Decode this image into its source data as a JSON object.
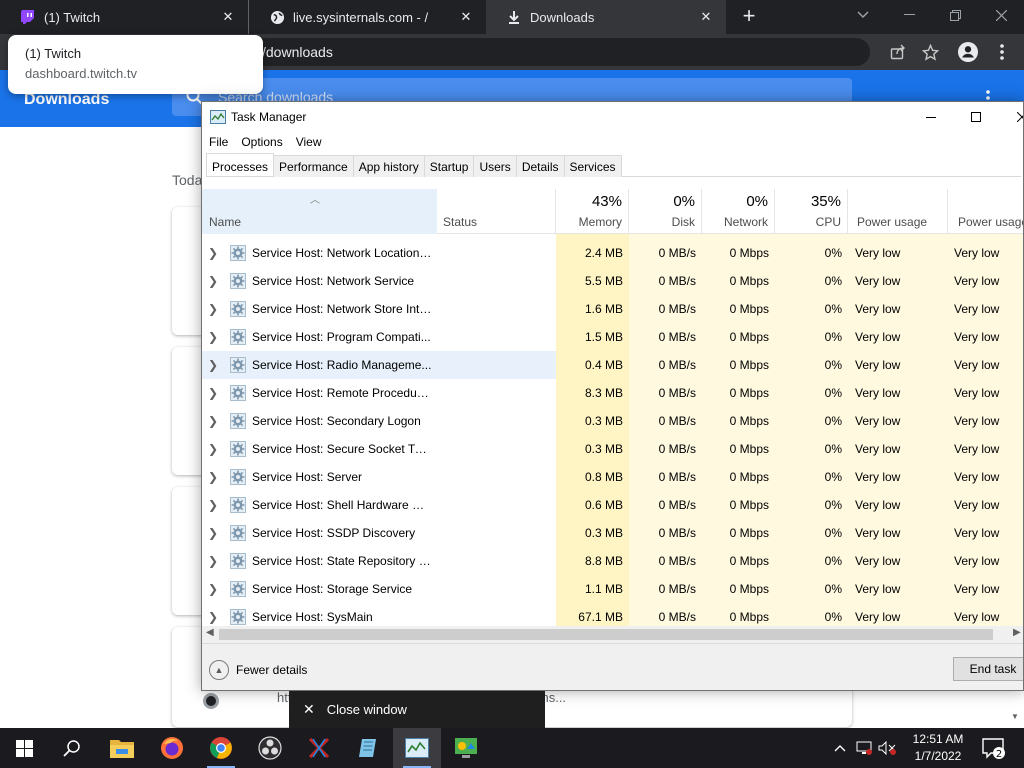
{
  "browser": {
    "tabs": [
      {
        "title": "(1) Twitch",
        "active": false
      },
      {
        "title": "live.sysinternals.com - /",
        "active": false
      },
      {
        "title": "Downloads",
        "active": true
      }
    ],
    "address": "/downloads",
    "tooltip": {
      "title": "(1) Twitch",
      "url": "dashboard.twitch.tv"
    }
  },
  "downloads": {
    "title": "Downloads",
    "search_placeholder": "Search downloads",
    "section": "Toda",
    "file_text": "https://...asy_epic_music_1_hour_orchestral_ins..."
  },
  "taskmgr": {
    "title": "Task Manager",
    "menu": [
      "File",
      "Options",
      "View"
    ],
    "tabs": [
      "Processes",
      "Performance",
      "App history",
      "Startup",
      "Users",
      "Details",
      "Services"
    ],
    "active_tab": "Processes",
    "columns": {
      "name": "Name",
      "status": "Status",
      "memory": {
        "pct": "43%",
        "label": "Memory"
      },
      "disk": {
        "pct": "0%",
        "label": "Disk"
      },
      "network": {
        "pct": "0%",
        "label": "Network"
      },
      "cpu": {
        "pct": "35%",
        "label": "CPU"
      },
      "power": "Power usage",
      "power_trend": "Power usage"
    },
    "rows": [
      {
        "name": "Service Host: Network Location ...",
        "memory": "2.4 MB",
        "disk": "0 MB/s",
        "network": "0 Mbps",
        "cpu": "0%",
        "power": "Very low",
        "power_trend": "Very low"
      },
      {
        "name": "Service Host: Network Service",
        "memory": "5.5 MB",
        "disk": "0 MB/s",
        "network": "0 Mbps",
        "cpu": "0%",
        "power": "Very low",
        "power_trend": "Very low"
      },
      {
        "name": "Service Host: Network Store Inte...",
        "memory": "1.6 MB",
        "disk": "0 MB/s",
        "network": "0 Mbps",
        "cpu": "0%",
        "power": "Very low",
        "power_trend": "Very low"
      },
      {
        "name": "Service Host: Program Compati...",
        "memory": "1.5 MB",
        "disk": "0 MB/s",
        "network": "0 Mbps",
        "cpu": "0%",
        "power": "Very low",
        "power_trend": "Very low"
      },
      {
        "name": "Service Host: Radio Manageme...",
        "memory": "0.4 MB",
        "disk": "0 MB/s",
        "network": "0 Mbps",
        "cpu": "0%",
        "power": "Very low",
        "power_trend": "Very low",
        "selected": true
      },
      {
        "name": "Service Host: Remote Procedure...",
        "memory": "8.3 MB",
        "disk": "0 MB/s",
        "network": "0 Mbps",
        "cpu": "0%",
        "power": "Very low",
        "power_trend": "Very low"
      },
      {
        "name": "Service Host: Secondary Logon",
        "memory": "0.3 MB",
        "disk": "0 MB/s",
        "network": "0 Mbps",
        "cpu": "0%",
        "power": "Very low",
        "power_trend": "Very low"
      },
      {
        "name": "Service Host: Secure Socket Tun...",
        "memory": "0.3 MB",
        "disk": "0 MB/s",
        "network": "0 Mbps",
        "cpu": "0%",
        "power": "Very low",
        "power_trend": "Very low"
      },
      {
        "name": "Service Host: Server",
        "memory": "0.8 MB",
        "disk": "0 MB/s",
        "network": "0 Mbps",
        "cpu": "0%",
        "power": "Very low",
        "power_trend": "Very low"
      },
      {
        "name": "Service Host: Shell Hardware De...",
        "memory": "0.6 MB",
        "disk": "0 MB/s",
        "network": "0 Mbps",
        "cpu": "0%",
        "power": "Very low",
        "power_trend": "Very low"
      },
      {
        "name": "Service Host: SSDP Discovery",
        "memory": "0.3 MB",
        "disk": "0 MB/s",
        "network": "0 Mbps",
        "cpu": "0%",
        "power": "Very low",
        "power_trend": "Very low"
      },
      {
        "name": "Service Host: State Repository S...",
        "memory": "8.8 MB",
        "disk": "0 MB/s",
        "network": "0 Mbps",
        "cpu": "0%",
        "power": "Very low",
        "power_trend": "Very low"
      },
      {
        "name": "Service Host: Storage Service",
        "memory": "1.1 MB",
        "disk": "0 MB/s",
        "network": "0 Mbps",
        "cpu": "0%",
        "power": "Very low",
        "power_trend": "Very low"
      },
      {
        "name": "Service Host: SysMain",
        "memory": "67.1 MB",
        "disk": "0 MB/s",
        "network": "0 Mbps",
        "cpu": "0%",
        "power": "Very low",
        "power_trend": "Very low"
      }
    ],
    "fewer_details": "Fewer details",
    "end_task": "End task"
  },
  "close_window": "Close window",
  "taskbar": {
    "time": "12:51 AM",
    "date": "1/7/2022",
    "notifications": "2"
  },
  "colors": {
    "chrome_dark": "#202124",
    "chrome_blue": "#1a73e8",
    "memory_heat": "#fff4c4",
    "cell_heat": "#fff9e0",
    "selection": "#e8f1fb"
  }
}
